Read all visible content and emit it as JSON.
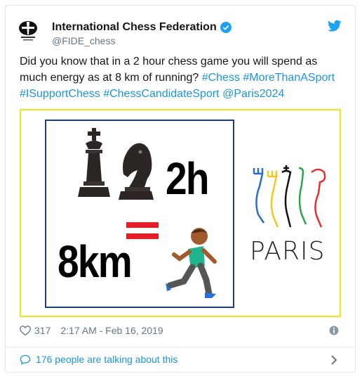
{
  "tweet": {
    "author_name": "International Chess Federation",
    "author_handle": "@FIDE_chess",
    "avatar_icon": "fide-logo-icon",
    "text_parts": {
      "p1": "Did you know that in a 2 hour chess game you will spend as much energy as at 8 km of running? ",
      "h1": "#Chess",
      "h2": "#MoreThanASport",
      "h3": "#ISupportChess",
      "h4": "#ChessCandidateSport",
      "h5": "@Paris2024"
    },
    "media": {
      "time_label": "2h",
      "distance_label": "8km",
      "paris_logo_text": "PARIS"
    },
    "likes": "317",
    "timestamp": "2:17 AM - Feb 16, 2019",
    "talking": "176 people are talking about this"
  },
  "colors": {
    "link": "#1b95e0",
    "media_border": "#f2e41c",
    "inner_border": "#1f3c88",
    "equals": "#e51d2a"
  }
}
